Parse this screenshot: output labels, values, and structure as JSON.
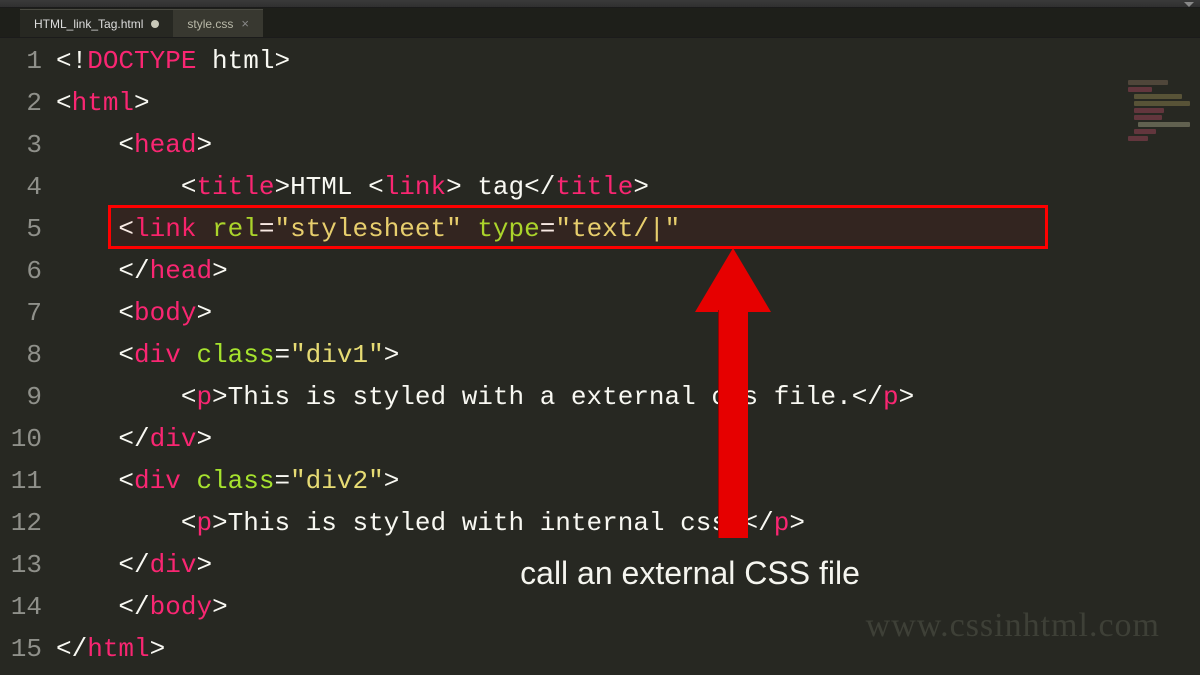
{
  "tabs": [
    {
      "label": "HTML_link_Tag.html",
      "active": true,
      "dirty": true
    },
    {
      "label": "style.css",
      "active": false,
      "dirty": false
    }
  ],
  "line_numbers": [
    "1",
    "2",
    "3",
    "4",
    "5",
    "6",
    "7",
    "8",
    "9",
    "10",
    "11",
    "12",
    "13",
    "14",
    "15"
  ],
  "code": {
    "l1": {
      "i0": "<!",
      "doctype": "DOCTYPE",
      "rest": " html",
      "i1": ">"
    },
    "l2": {
      "open": "<",
      "tag": "html",
      "close": ">"
    },
    "l3": {
      "indent": "    ",
      "open": "<",
      "tag": "head",
      "close": ">"
    },
    "l4": {
      "indent": "        ",
      "o1": "<",
      "t1": "title",
      "c1": ">",
      "txt1": "HTML ",
      "o2": "<",
      "t2": "link",
      "c2": ">",
      "txt2": " tag",
      "o3": "</",
      "t3": "title",
      "c3": ">"
    },
    "l5": {
      "indent": "    ",
      "open": "<",
      "tag": "link",
      "sp1": " ",
      "a1": "rel",
      "eq1": "=",
      "v1": "\"stylesheet\"",
      "sp2": " ",
      "a2": "type",
      "eq2": "=",
      "v2": "\"text/|\""
    },
    "l6": {
      "indent": "    ",
      "open": "</",
      "tag": "head",
      "close": ">"
    },
    "l7": {
      "indent": "    ",
      "open": "<",
      "tag": "body",
      "close": ">"
    },
    "l8": {
      "indent": "    ",
      "open": "<",
      "tag": "div",
      "sp": " ",
      "a": "class",
      "eq": "=",
      "v": "\"div1\"",
      "close": ">"
    },
    "l9": {
      "indent": "        ",
      "o1": "<",
      "t1": "p",
      "c1": ">",
      "txt": "This is styled with a external css file.",
      "o2": "</",
      "t2": "p",
      "c2": ">"
    },
    "l10": {
      "indent": "    ",
      "open": "</",
      "tag": "div",
      "close": ">"
    },
    "l11": {
      "indent": "    ",
      "open": "<",
      "tag": "div",
      "sp": " ",
      "a": "class",
      "eq": "=",
      "v": "\"div2\"",
      "close": ">"
    },
    "l12": {
      "indent": "        ",
      "o1": "<",
      "t1": "p",
      "c1": ">",
      "txt": "This is styled with internal css.",
      "o2": "</",
      "t2": "p",
      "c2": ">"
    },
    "l13": {
      "indent": "    ",
      "open": "</",
      "tag": "div",
      "close": ">"
    },
    "l14": {
      "indent": "    ",
      "open": "</",
      "tag": "body",
      "close": ">"
    },
    "l15": {
      "open": "</",
      "tag": "html",
      "close": ">"
    }
  },
  "annotation": {
    "caption": "call an external CSS file",
    "watermark": "www.cssinhtml.com"
  },
  "colors": {
    "highlight": "#ff0000",
    "arrow": "#e60000"
  }
}
